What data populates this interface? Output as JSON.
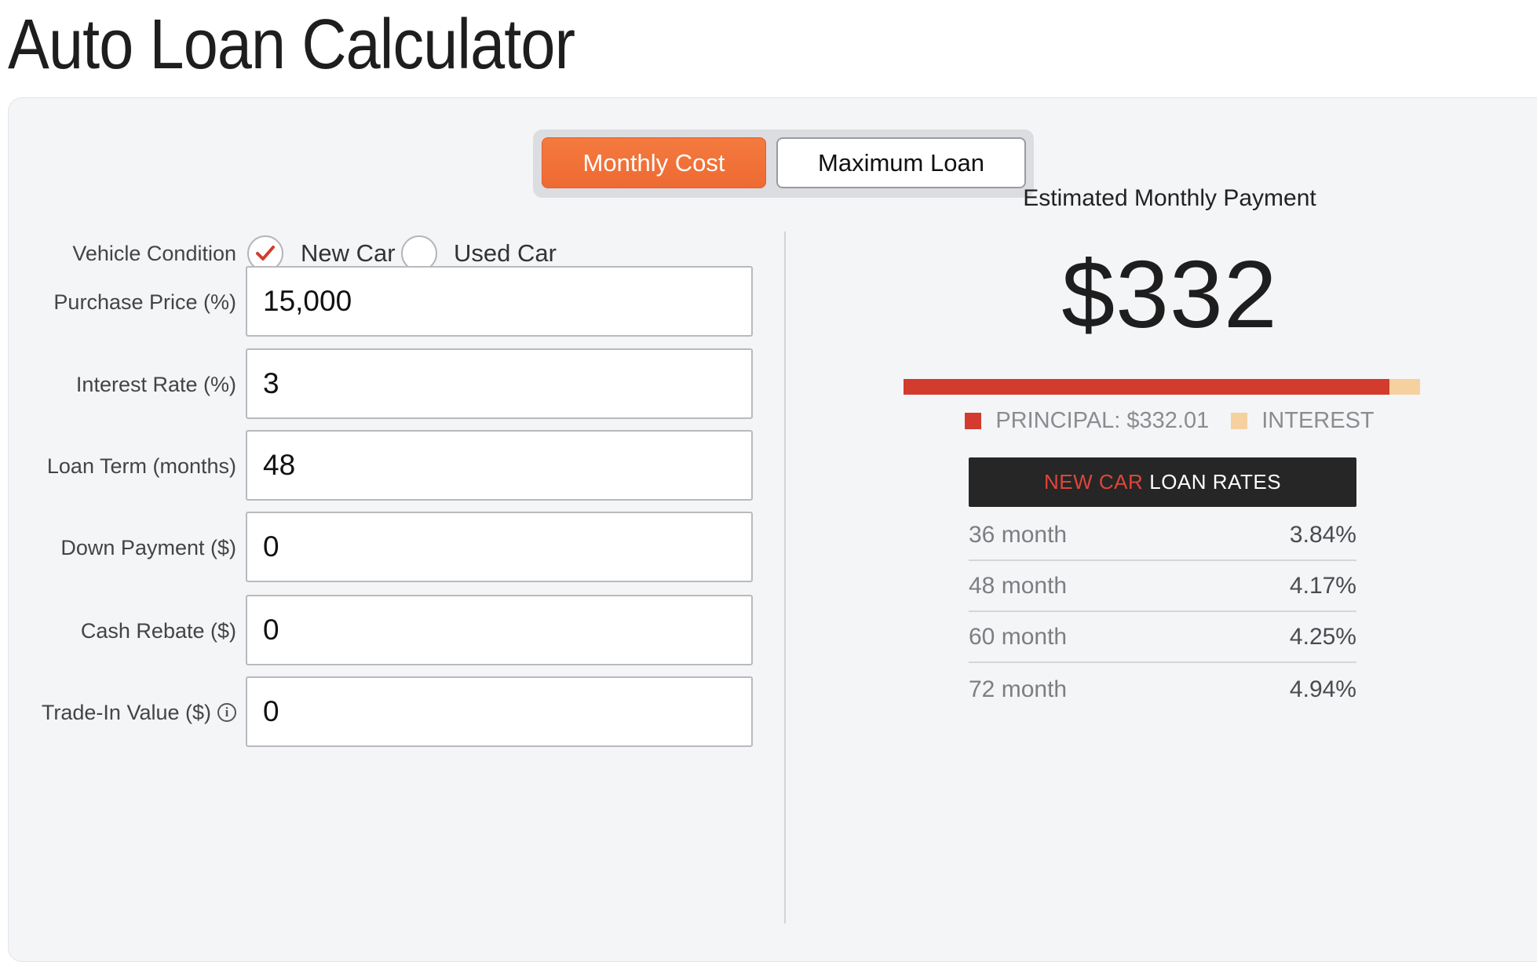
{
  "page_title": "Auto Loan Calculator",
  "tabs": [
    {
      "label": "Monthly Cost",
      "active": true
    },
    {
      "label": "Maximum Loan",
      "active": false
    }
  ],
  "form": {
    "vehicle_condition": {
      "label": "Vehicle Condition",
      "options": [
        {
          "label": "New Car",
          "selected": true
        },
        {
          "label": "Used Car",
          "selected": false
        }
      ]
    },
    "purchase_price": {
      "label": "Purchase Price (%)",
      "value": "15,000"
    },
    "interest_rate": {
      "label": "Interest Rate (%)",
      "value": "3"
    },
    "loan_term": {
      "label": "Loan Term (months)",
      "value": "48"
    },
    "down_payment": {
      "label": "Down Payment ($)",
      "value": "0"
    },
    "cash_rebate": {
      "label": "Cash Rebate ($)",
      "value": "0"
    },
    "trade_in": {
      "label": "Trade-In Value ($)",
      "value": "0",
      "icon": "info-icon"
    }
  },
  "result": {
    "title": "Estimated Monthly Payment",
    "amount": "$332",
    "principal_fraction": 0.94,
    "legend": {
      "principal": "PRINCIPAL: $332.01",
      "interest": "INTEREST"
    }
  },
  "rates": {
    "header_accent": "NEW CAR",
    "header_rest": "LOAN RATES",
    "rows": [
      {
        "term": "36 month",
        "rate": "3.84%"
      },
      {
        "term": "48 month",
        "rate": "4.17%"
      },
      {
        "term": "60 month",
        "rate": "4.25%"
      },
      {
        "term": "72 month",
        "rate": "4.94%"
      }
    ]
  },
  "colors": {
    "accent_orange": "#f47a3e",
    "principal_red": "#d23b2e",
    "interest_peach": "#f7d0a0",
    "check_red": "#d23b2e"
  }
}
